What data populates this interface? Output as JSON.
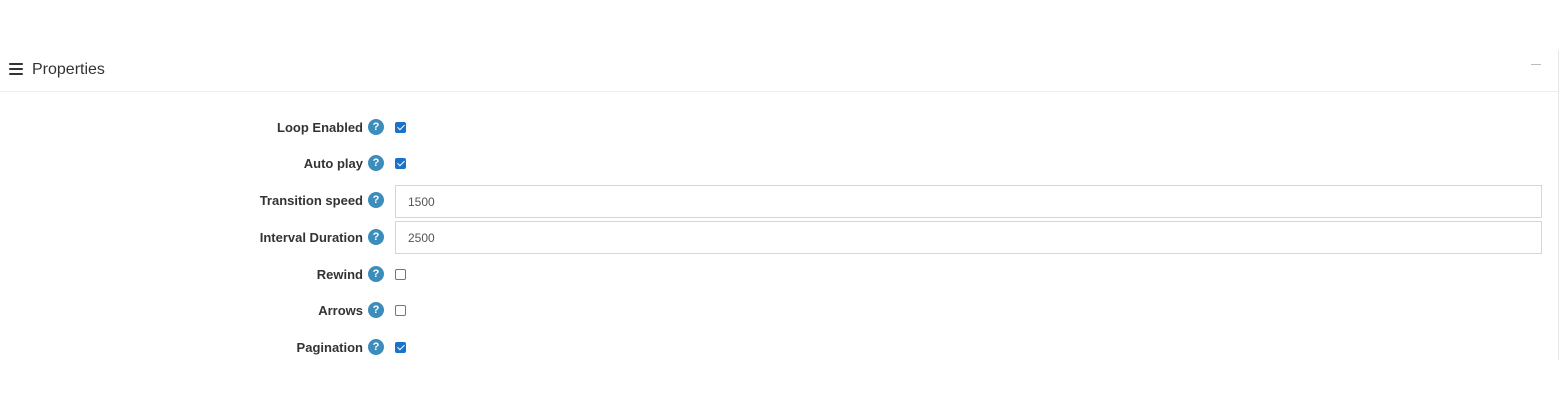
{
  "panel": {
    "title": "Properties",
    "collapse_icon": "minus-icon",
    "menu_icon": "hamburger-icon"
  },
  "fields": {
    "loop_enabled": {
      "label": "Loop Enabled",
      "type": "checkbox",
      "checked": true
    },
    "auto_play": {
      "label": "Auto play",
      "type": "checkbox",
      "checked": true
    },
    "transition_speed": {
      "label": "Transition speed",
      "type": "text",
      "value": "1500"
    },
    "interval_duration": {
      "label": "Interval Duration",
      "type": "text",
      "value": "2500"
    },
    "rewind": {
      "label": "Rewind",
      "type": "checkbox",
      "checked": false
    },
    "arrows": {
      "label": "Arrows",
      "type": "checkbox",
      "checked": false
    },
    "pagination": {
      "label": "Pagination",
      "type": "checkbox",
      "checked": true
    }
  },
  "help_glyph": "?",
  "colors": {
    "help_icon": "#3c8dbc",
    "checkbox_checked": "#1a73c9",
    "input_border": "#d2d6de"
  }
}
